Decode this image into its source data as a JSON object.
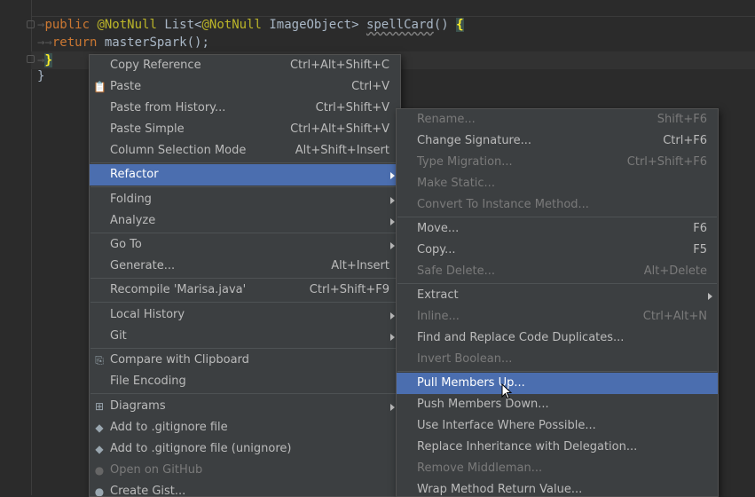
{
  "code": {
    "line1": {
      "kw": "public",
      "ann1": "@NotNull",
      "type": "List<",
      "ann2": "@NotNull",
      "type2": "ImageObject>",
      "fn": "spellCard",
      "paren": "()",
      "brace": "{"
    },
    "line2": {
      "kw": "return",
      "rest": "masterSpark();"
    },
    "line3": {
      "brace": "}"
    },
    "line4": {
      "brace": "}"
    }
  },
  "context_menu": [
    {
      "label": "Copy Reference",
      "shortcut": "Ctrl+Alt+Shift+C"
    },
    {
      "label": "Paste",
      "shortcut": "Ctrl+V",
      "icon": "clipboard-icon"
    },
    {
      "label": "Paste from History...",
      "shortcut": "Ctrl+Shift+V"
    },
    {
      "label": "Paste Simple",
      "shortcut": "Ctrl+Alt+Shift+V"
    },
    {
      "label": "Column Selection Mode",
      "shortcut": "Alt+Shift+Insert"
    },
    {
      "label": "Refactor",
      "submenu": true,
      "selected": true
    },
    {
      "label": "Folding",
      "submenu": true
    },
    {
      "label": "Analyze",
      "submenu": true
    },
    {
      "label": "Go To",
      "submenu": true
    },
    {
      "label": "Generate...",
      "shortcut": "Alt+Insert"
    },
    {
      "label": "Recompile 'Marisa.java'",
      "shortcut": "Ctrl+Shift+F9"
    },
    {
      "label": "Local History",
      "submenu": true
    },
    {
      "label": "Git",
      "submenu": true
    },
    {
      "label": "Compare with Clipboard",
      "icon": "compare-icon"
    },
    {
      "label": "File Encoding"
    },
    {
      "label": "Diagrams",
      "submenu": true,
      "icon": "diagram-icon"
    },
    {
      "label": "Add to .gitignore file",
      "icon": "gitignore-icon"
    },
    {
      "label": "Add to .gitignore file (unignore)",
      "icon": "gitignore-icon"
    },
    {
      "label": "Open on GitHub",
      "icon": "github-icon",
      "disabled": true
    },
    {
      "label": "Create Gist...",
      "icon": "github-icon"
    }
  ],
  "refactor_menu": [
    {
      "label": "Rename...",
      "shortcut": "Shift+F6",
      "disabled": true
    },
    {
      "label": "Change Signature...",
      "shortcut": "Ctrl+F6"
    },
    {
      "label": "Type Migration...",
      "shortcut": "Ctrl+Shift+F6",
      "disabled": true
    },
    {
      "label": "Make Static...",
      "disabled": true
    },
    {
      "label": "Convert To Instance Method...",
      "disabled": true
    },
    {
      "label": "Move...",
      "shortcut": "F6"
    },
    {
      "label": "Copy...",
      "shortcut": "F5"
    },
    {
      "label": "Safe Delete...",
      "shortcut": "Alt+Delete",
      "disabled": true
    },
    {
      "label": "Extract",
      "submenu": true
    },
    {
      "label": "Inline...",
      "shortcut": "Ctrl+Alt+N",
      "disabled": true
    },
    {
      "label": "Find and Replace Code Duplicates..."
    },
    {
      "label": "Invert Boolean...",
      "disabled": true
    },
    {
      "label": "Pull Members Up...",
      "selected": true
    },
    {
      "label": "Push Members Down..."
    },
    {
      "label": "Use Interface Where Possible..."
    },
    {
      "label": "Replace Inheritance with Delegation..."
    },
    {
      "label": "Remove Middleman...",
      "disabled": true
    },
    {
      "label": "Wrap Method Return Value..."
    }
  ],
  "colors": {
    "background": "#2b2b2b",
    "menu": "#3c3f41",
    "selection": "#4b6eaf",
    "keyword": "#cc7832",
    "annotation": "#bbb529"
  }
}
